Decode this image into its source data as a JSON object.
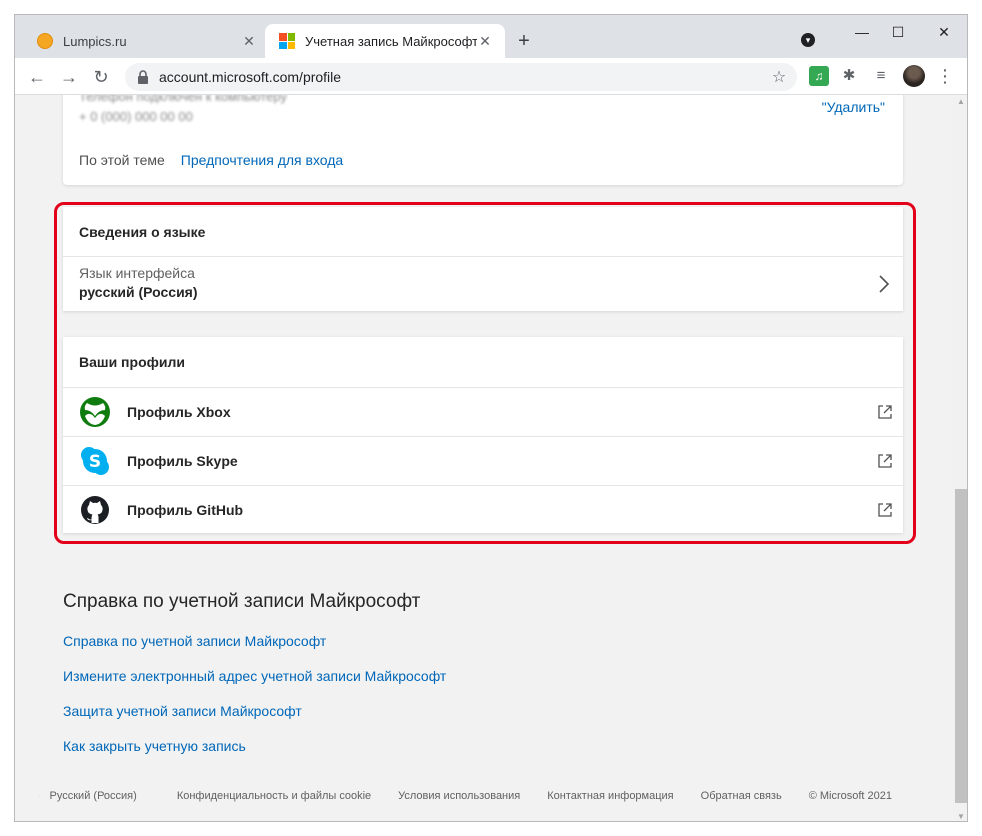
{
  "browser": {
    "tabs": [
      {
        "title": "Lumpics.ru",
        "icon": "orange-circle-favicon",
        "close": "✕"
      },
      {
        "title": "Учетная запись Майкрософт | Y",
        "icon": "microsoft-favicon",
        "close": "✕"
      }
    ],
    "new_tab": "+",
    "window_controls": {
      "minimize": "—",
      "maximize": "☐",
      "close": "✕"
    },
    "nav": {
      "back": "←",
      "forward": "→",
      "reload": "↻"
    },
    "url": "account.microsoft.com/profile",
    "bookmark": "☆",
    "extensions": {
      "music": "♫",
      "puzzle": "✱",
      "media": "≡"
    },
    "menu": "⋮"
  },
  "top_card": {
    "blurred_line1": "Телефон подключен к компьютеру",
    "blurred_line2": "+ 0 (000) 000 00 00",
    "remove": "\"Удалить\"",
    "topic_label": "По этой теме",
    "topic_link": "Предпочтения для входа"
  },
  "language": {
    "heading": "Сведения о языке",
    "label": "Язык интерфейса",
    "value": "русский (Россия)"
  },
  "profiles": {
    "heading": "Ваши профили",
    "items": [
      {
        "name": "Профиль Xbox",
        "icon": "xbox-icon"
      },
      {
        "name": "Профиль Skype",
        "icon": "skype-icon"
      },
      {
        "name": "Профиль GitHub",
        "icon": "github-icon"
      }
    ]
  },
  "help": {
    "title": "Справка по учетной записи Майкрософт",
    "links": [
      "Справка по учетной записи Майкрософт",
      "Измените электронный адрес учетной записи Майкрософт",
      "Защита учетной записи Майкрософт",
      "Как закрыть учетную запись"
    ]
  },
  "footer": {
    "language": "Русский (Россия)",
    "privacy": "Конфиденциальность и файлы cookie",
    "terms": "Условия использования",
    "contact": "Контактная информация",
    "feedback": "Обратная связь",
    "copyright": "© Microsoft 2021"
  },
  "colors": {
    "link": "#0067b8",
    "highlight": "#e3001b",
    "xbox": "#107c10",
    "skype": "#00aff0"
  }
}
